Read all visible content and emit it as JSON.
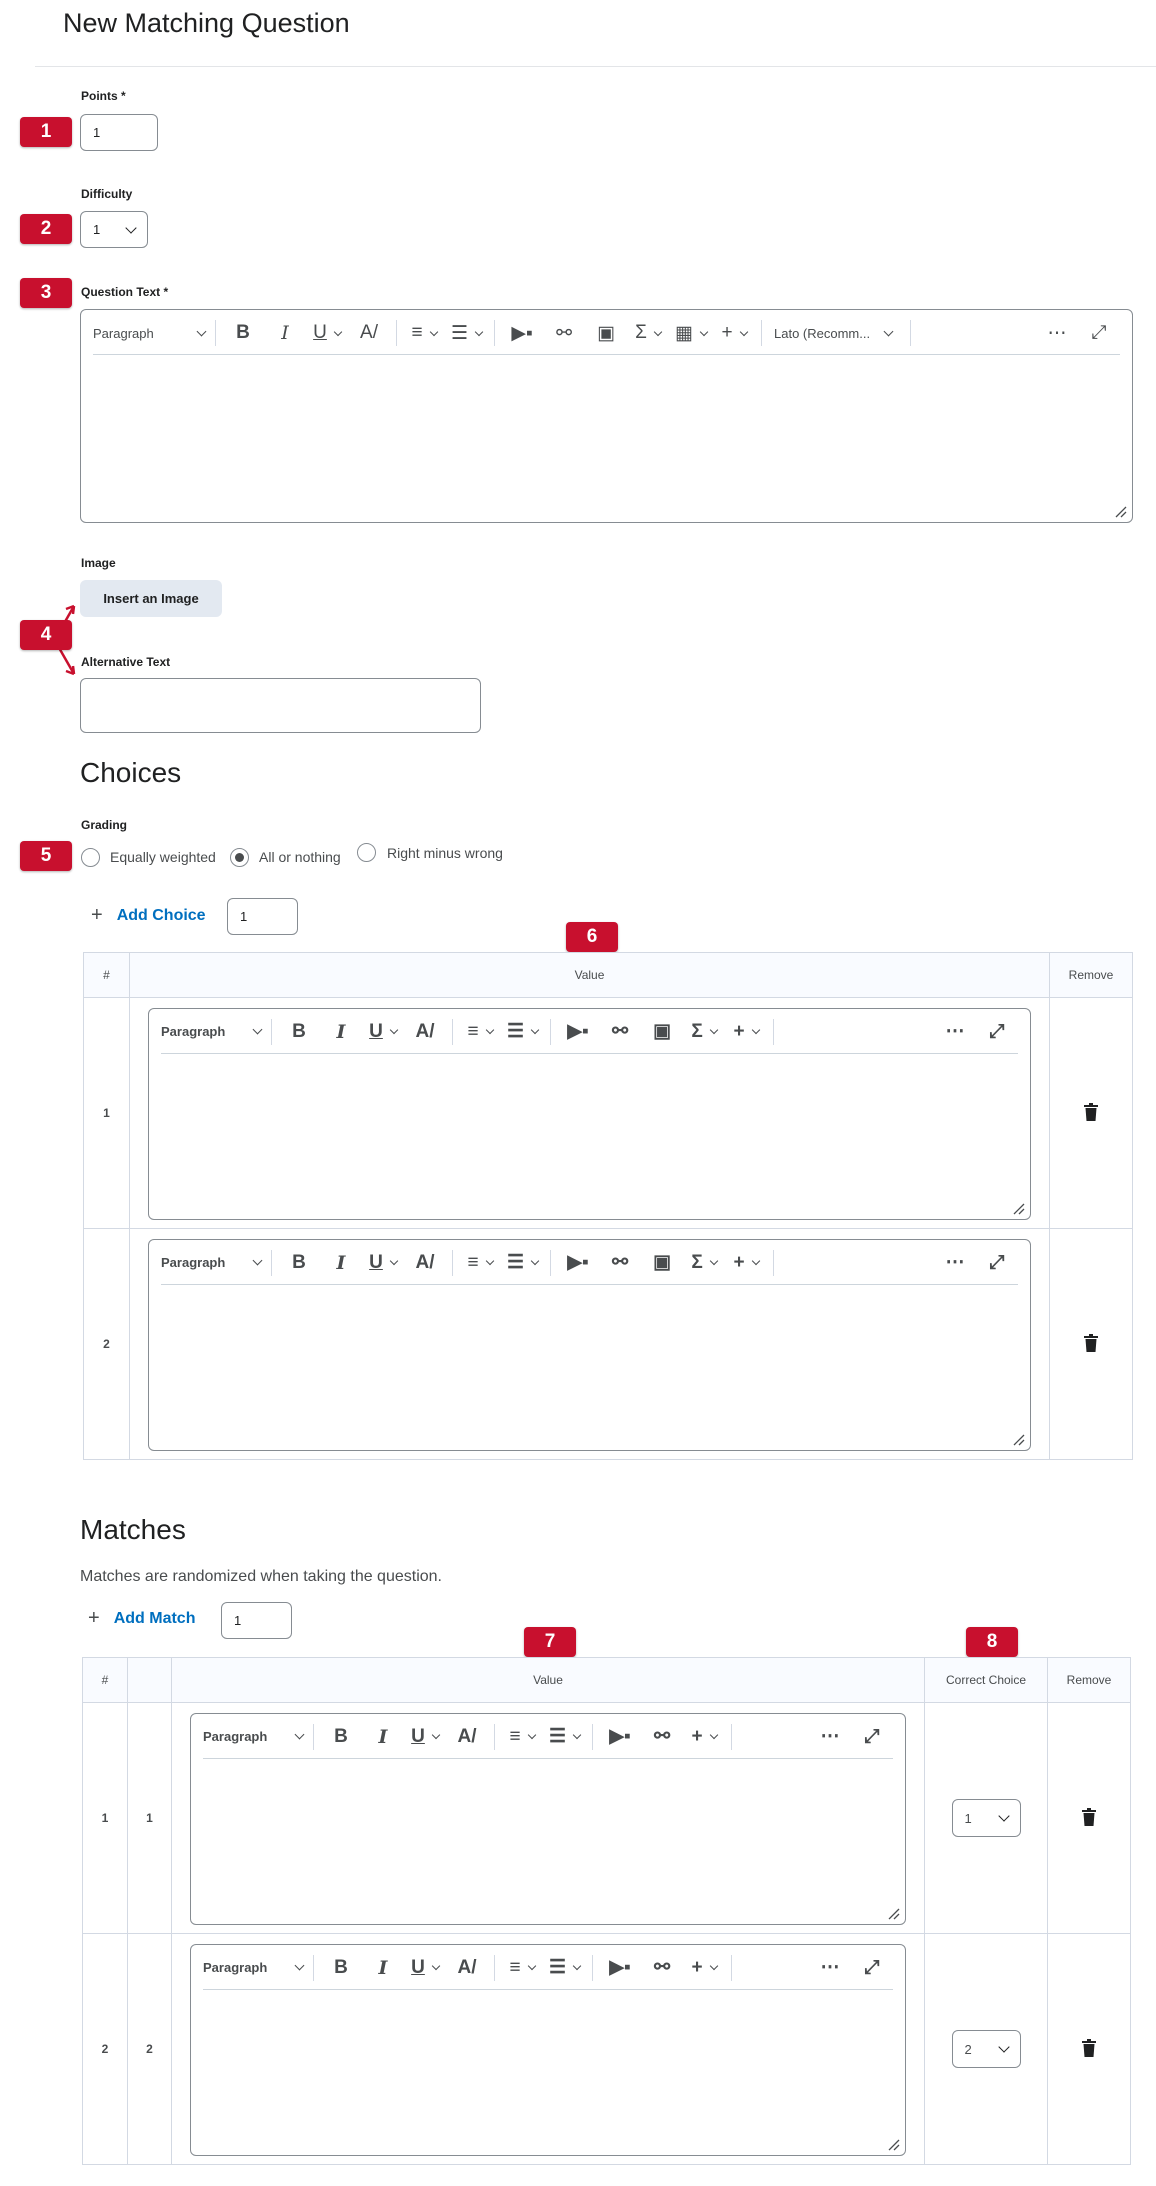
{
  "page": {
    "title": "New Matching Question"
  },
  "badges": [
    "1",
    "2",
    "3",
    "4",
    "5",
    "6",
    "7",
    "8"
  ],
  "points": {
    "label": "Points *",
    "value": "1"
  },
  "difficulty": {
    "label": "Difficulty",
    "value": "1"
  },
  "question_text": {
    "label": "Question Text *",
    "font_select": "Lato (Recomm..."
  },
  "toolbar": {
    "paragraph": "Paragraph"
  },
  "image": {
    "label": "Image",
    "button": "Insert an Image"
  },
  "alt_text": {
    "label": "Alternative Text",
    "value": ""
  },
  "choices": {
    "heading": "Choices",
    "grading_label": "Grading",
    "grading_options": [
      "Equally weighted",
      "All or nothing",
      "Right minus wrong"
    ],
    "selected_option": "All or nothing",
    "add_label": "Add Choice",
    "add_count": "1",
    "columns": [
      "#",
      "Value",
      "Remove"
    ],
    "rows": [
      {
        "num": "1"
      },
      {
        "num": "2"
      }
    ]
  },
  "matches": {
    "heading": "Matches",
    "note": "Matches are randomized when taking the question.",
    "add_label": "Add Match",
    "add_count": "1",
    "columns": [
      "#",
      "",
      "Value",
      "Correct Choice",
      "Remove"
    ],
    "rows": [
      {
        "num": "1",
        "sub": "1",
        "correct": "1"
      },
      {
        "num": "2",
        "sub": "2",
        "correct": "2"
      }
    ]
  },
  "colors": {
    "badge": "#c8102e",
    "link": "#006fbf",
    "border": "#868c92"
  }
}
